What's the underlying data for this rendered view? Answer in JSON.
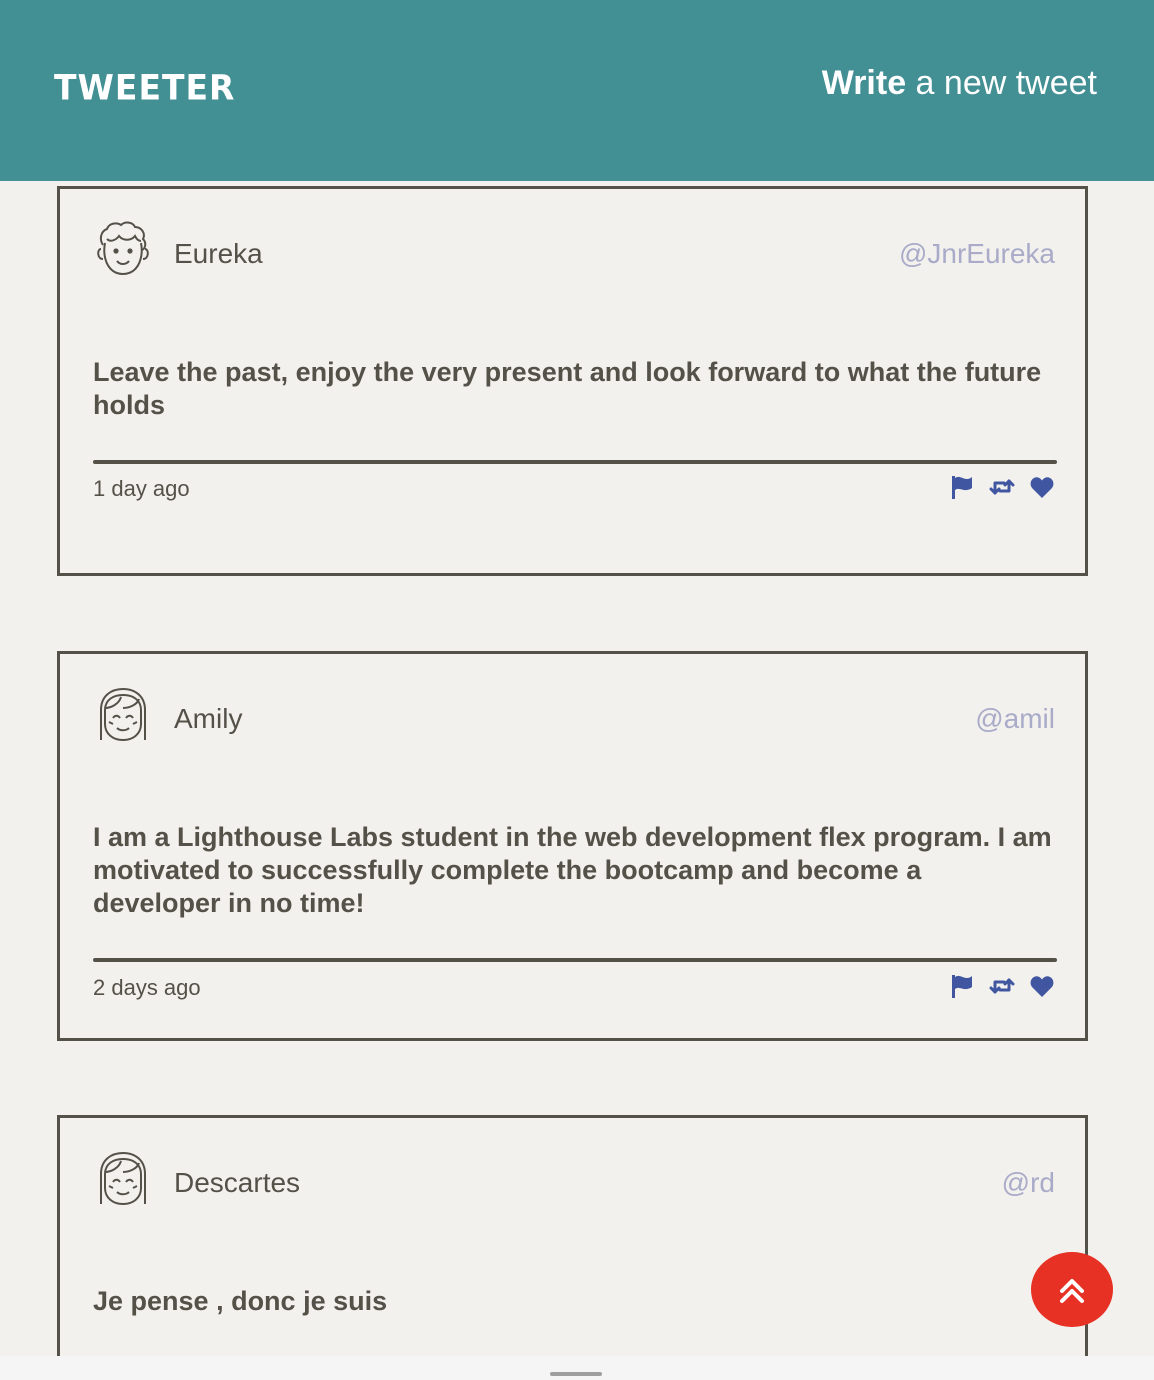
{
  "nav": {
    "brand": "TWEETER",
    "compose_bold": "Write",
    "compose_rest": " a new tweet"
  },
  "tweets": [
    {
      "name": "Eureka",
      "handle": "@JnrEureka",
      "content": "Leave the past, enjoy the very present and look forward to what the future holds",
      "age": "1 day ago",
      "avatar": "avatar-curly-hair-icon"
    },
    {
      "name": "Amily",
      "handle": "@amil",
      "content": "I am a Lighthouse Labs student in the web development flex program. I am motivated to successfully complete the bootcamp and become a developer in no time!",
      "age": "2 days ago",
      "avatar": "avatar-bangs-icon"
    },
    {
      "name": "Descartes",
      "handle": "@rd",
      "content": "Je pense , donc je suis",
      "avatar": "avatar-bangs-icon"
    }
  ],
  "colors": {
    "header": "#428f94",
    "background": "#f3f1ed",
    "text": "#545149",
    "handle": "#a9abc9",
    "icon": "#4056a1",
    "scroll_button": "#e73124"
  },
  "icons": [
    "flag-icon",
    "retweet-icon",
    "heart-icon",
    "double-chevron-up-icon"
  ]
}
